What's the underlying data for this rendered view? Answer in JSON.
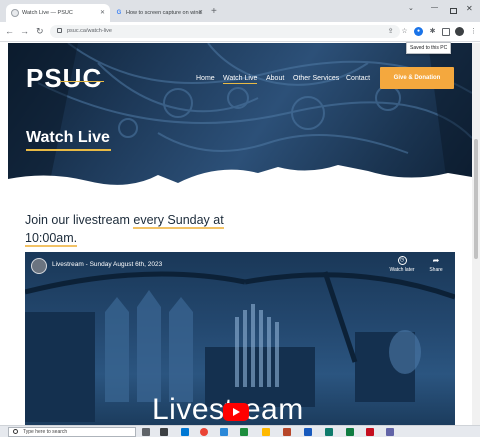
{
  "browser": {
    "tabs": [
      {
        "title": "Watch Live — PSUC",
        "active": true
      },
      {
        "title": "How to screen capture on wind",
        "active": false
      }
    ],
    "url": "psuc.ca/watch-live",
    "tooltip": "Saved to this PC"
  },
  "site": {
    "logo": "PSUC",
    "nav": [
      "Home",
      "Watch Live",
      "About",
      "Other Services",
      "Contact"
    ],
    "give_button": "Give & Donation",
    "hero_title": "Watch Live"
  },
  "content": {
    "join_prefix": "Join our livestream ",
    "join_highlight_1": "every Sunday at",
    "join_highlight_2": "10:00am."
  },
  "video": {
    "title": "Livestream - Sunday August 6th, 2023",
    "watch_later": "Watch later",
    "share": "Share",
    "caption": "Livestream"
  },
  "taskbar": {
    "search_placeholder": "Type here to search"
  },
  "colors": {
    "accent_gold": "#e8ba45",
    "give_orange": "#f4a83e",
    "youtube_red": "#ff0000",
    "hero_navy": "#1e3a5a"
  }
}
